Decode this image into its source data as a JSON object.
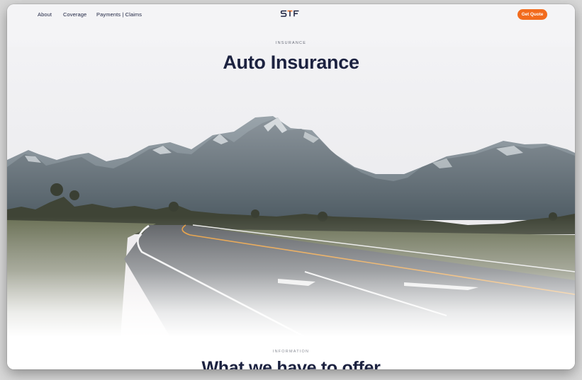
{
  "nav": {
    "links": [
      "About",
      "Coverage",
      "Payments | Claims"
    ],
    "logo_text": "STF",
    "cta_label": "Get Quote"
  },
  "hero": {
    "eyebrow": "INSURANCE",
    "title": "Auto Insurance"
  },
  "info": {
    "eyebrow": "INFORMATION",
    "title": "What we have to offer"
  },
  "colors": {
    "navy": "#1c2240",
    "accent": "#f26b1d",
    "road_line": "#e59a3a"
  }
}
